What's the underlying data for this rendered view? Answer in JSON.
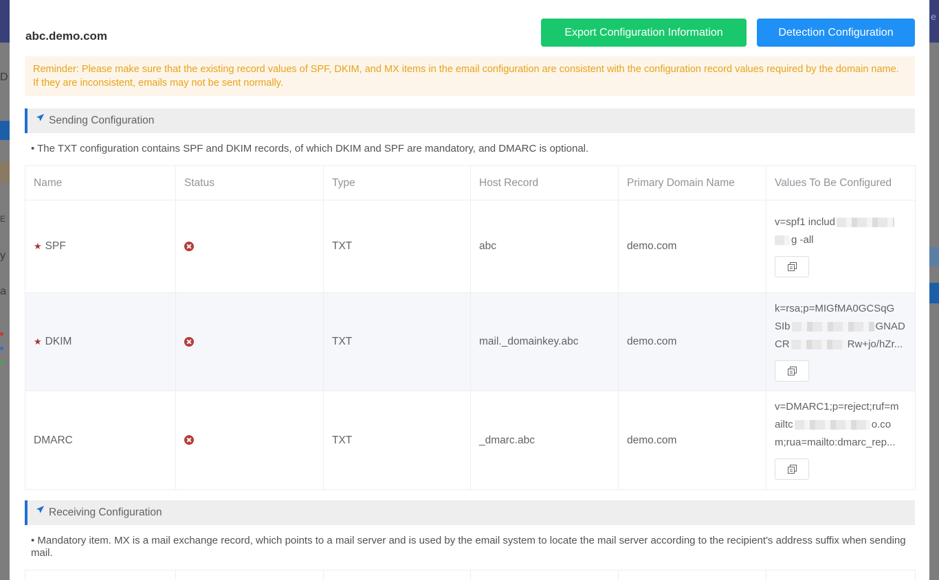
{
  "dialog": {
    "domain": "abc.demo.com",
    "buttons": {
      "export": "Export Configuration Information",
      "detect": "Detection Configuration"
    },
    "reminder": "Reminder: Please make sure that the existing record values of SPF, DKIM, and MX items in the email configuration are consistent with the configuration record values required by the domain name. If they are inconsistent, emails may not be sent normally."
  },
  "sending": {
    "title": "Sending Configuration",
    "note": "• The TXT configuration contains SPF and DKIM records, of which DKIM and SPF are mandatory, and DMARC is optional.",
    "columns": [
      "Name",
      "Status",
      "Type",
      "Host Record",
      "Primary Domain Name",
      "Values To Be Configured"
    ],
    "rows": [
      {
        "name": "SPF",
        "mandatory": true,
        "type": "TXT",
        "host": "abc",
        "domain": "demo.com",
        "value_lines": [
          "v=spf1 includ",
          "g -all"
        ]
      },
      {
        "name": "DKIM",
        "mandatory": true,
        "type": "TXT",
        "host": "mail._domainkey.abc",
        "domain": "demo.com",
        "value_lines": [
          "k=rsa;p=MIGfMA0GCSqG",
          "SIb",
          "GNAD",
          "CR",
          "Rw+jo/hZr..."
        ]
      },
      {
        "name": "DMARC",
        "mandatory": false,
        "type": "TXT",
        "host": "_dmarc.abc",
        "domain": "demo.com",
        "value_lines": [
          "v=DMARC1;p=reject;ruf=m",
          "ailtc",
          "o.co",
          "m;rua=mailto:dmarc_rep..."
        ]
      }
    ]
  },
  "receiving": {
    "title": "Receiving Configuration",
    "note": "• Mandatory item. MX is a mail exchange record, which points to a mail server and is used by the email system to locate the mail server according to the recipient's address suffix when sending mail."
  },
  "colors": {
    "export_button": "#19c86c",
    "detect_button": "#1f90f5",
    "reminder_text": "#e8a31a",
    "status_error": "#b63c3a",
    "section_accent": "#1f6ed6"
  }
}
